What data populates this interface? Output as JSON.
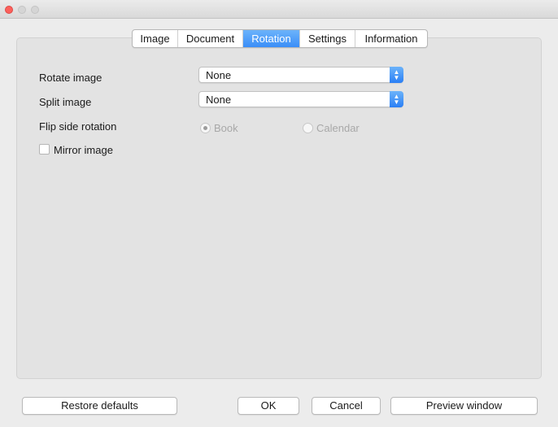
{
  "window": {
    "traffic_lights": [
      {
        "name": "close",
        "color": "#fc605c"
      },
      {
        "name": "minimize",
        "color": "#d5d5d5"
      },
      {
        "name": "zoom",
        "color": "#d5d5d5"
      }
    ]
  },
  "tabs": [
    {
      "label": "Image",
      "active": false
    },
    {
      "label": "Document",
      "active": false
    },
    {
      "label": "Rotation",
      "active": true
    },
    {
      "label": "Settings",
      "active": false
    },
    {
      "label": "Information",
      "active": false
    }
  ],
  "rotation": {
    "rotate_image": {
      "label": "Rotate image",
      "value": "None"
    },
    "split_image": {
      "label": "Split image",
      "value": "None"
    },
    "flip_side_rotation": {
      "label": "Flip side rotation",
      "options": [
        {
          "label": "Book",
          "selected": true
        },
        {
          "label": "Calendar",
          "selected": false
        }
      ],
      "disabled": true
    },
    "mirror_image": {
      "label": "Mirror image",
      "checked": false
    }
  },
  "buttons": {
    "restore_defaults": "Restore defaults",
    "ok": "OK",
    "cancel": "Cancel",
    "preview_window": "Preview window"
  },
  "colors": {
    "accent": "#3a8ef8",
    "window_bg": "#ececec",
    "panel_bg": "#e3e3e3",
    "disabled_text": "#a8a8a8"
  }
}
